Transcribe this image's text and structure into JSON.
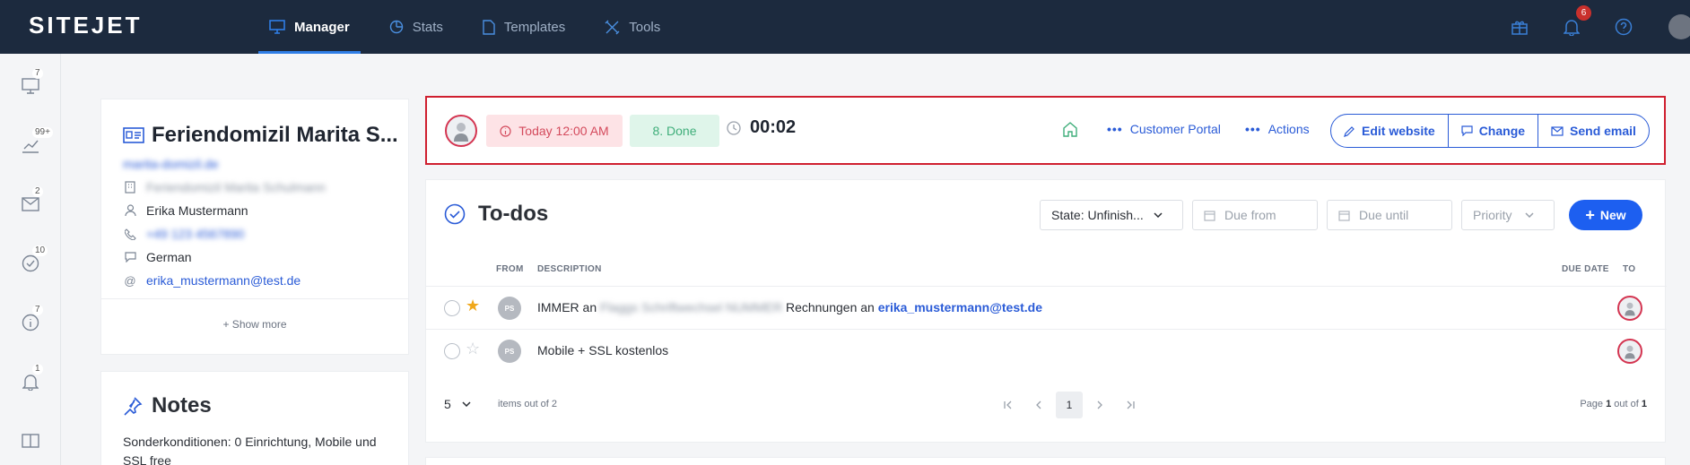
{
  "app": {
    "logo": "SITEJET"
  },
  "nav": {
    "items": [
      {
        "label": "Manager",
        "icon": "monitor-icon",
        "active": true
      },
      {
        "label": "Stats",
        "icon": "pie-chart-icon",
        "active": false
      },
      {
        "label": "Templates",
        "icon": "document-icon",
        "active": false
      },
      {
        "label": "Tools",
        "icon": "tools-icon",
        "active": false
      }
    ],
    "notifications_count": "6"
  },
  "rail": {
    "badges": [
      "7",
      "99+",
      "2",
      "10",
      "7",
      "1"
    ]
  },
  "client": {
    "title": "Feriendomizil Marita S...",
    "website": "marita-domizil.de",
    "company": "Feriendomizil Marita Schulmann",
    "contact_name": "Erika Mustermann",
    "phone": "+49 123 4567890",
    "language": "German",
    "email": "erika_mustermann@test.de",
    "show_more": "+ Show more"
  },
  "notes": {
    "title": "Notes",
    "text": "Sonderkonditionen: 0 Einrichtung, Mobile und SSL free"
  },
  "header": {
    "date_label": "Today 12:00 AM",
    "status_label": "8. Done",
    "timer": "00:02",
    "customer_portal": "Customer Portal",
    "actions": "Actions",
    "edit_website": "Edit website",
    "change": "Change",
    "send_email": "Send email",
    "colors": {
      "accent": "#2a5bd7",
      "highlight_border": "#cf1f2f"
    }
  },
  "todos": {
    "title": "To-dos",
    "state_filter": "State: Unfinish...",
    "due_from_placeholder": "Due from",
    "due_until_placeholder": "Due until",
    "priority_placeholder": "Priority",
    "new_label": "New",
    "columns": {
      "from": "FROM",
      "description": "DESCRIPTION",
      "due_date": "DUE DATE",
      "to": "TO"
    },
    "rows": [
      {
        "starred": true,
        "from": "PS",
        "desc_prefix": "IMMER an ",
        "desc_blurred": "Flaggs Schriftwechsel NUMMER",
        "desc_mid": " Rechnungen an ",
        "desc_link": "erika_mustermann@test.de"
      },
      {
        "starred": false,
        "from": "PS",
        "desc_prefix": "Mobile + SSL kostenlos",
        "desc_blurred": "",
        "desc_mid": "",
        "desc_link": ""
      }
    ],
    "pager": {
      "page_size": "5",
      "items_out": "items out of 2",
      "current_page": "1",
      "page_label": "Page",
      "page_num": "1",
      "out_of": "out of",
      "total_pages": "1"
    }
  }
}
